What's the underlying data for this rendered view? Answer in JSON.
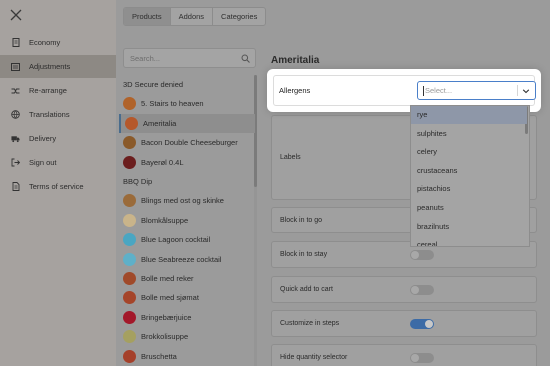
{
  "sidebar": {
    "items": [
      {
        "label": "Economy",
        "icon": "receipt-icon"
      },
      {
        "label": "Adjustments",
        "icon": "sliders-icon"
      },
      {
        "label": "Re-arrange",
        "icon": "shuffle-icon"
      },
      {
        "label": "Translations",
        "icon": "globe-icon"
      },
      {
        "label": "Delivery",
        "icon": "truck-icon"
      },
      {
        "label": "Sign out",
        "icon": "sign-out-icon"
      },
      {
        "label": "Terms of service",
        "icon": "document-icon"
      }
    ]
  },
  "tabs": [
    "Products",
    "Addons",
    "Categories"
  ],
  "search": {
    "placeholder": "Search..."
  },
  "products": [
    {
      "label": "3D Secure denied",
      "type": "group"
    },
    {
      "label": "5. Stairs to heaven",
      "type": "item",
      "color": "#b0632a"
    },
    {
      "label": "Ameritalia",
      "type": "item",
      "color": "#b5582b",
      "selected": true
    },
    {
      "label": "Bacon Double Cheeseburger",
      "type": "item",
      "color": "#8a5a2a"
    },
    {
      "label": "Bayerøl 0.4L",
      "type": "item",
      "color": "#6b1e1e"
    },
    {
      "label": "BBQ Dip",
      "type": "group"
    },
    {
      "label": "Blings med ost og skinke",
      "type": "item",
      "color": "#9a6b3a"
    },
    {
      "label": "Blomkålsuppe",
      "type": "item",
      "color": "#c9b48a"
    },
    {
      "label": "Blue Lagoon cocktail",
      "type": "item",
      "color": "#4aa6c2"
    },
    {
      "label": "Blue Seabreeze cocktail",
      "type": "item",
      "color": "#5fb0c8"
    },
    {
      "label": "Bolle med reker",
      "type": "item",
      "color": "#a04a2a"
    },
    {
      "label": "Bolle med sjømat",
      "type": "item",
      "color": "#a5452a"
    },
    {
      "label": "Bringebærjuice",
      "type": "item",
      "color": "#a3182a"
    },
    {
      "label": "Brokkolisuppe",
      "type": "item",
      "color": "#a5a060"
    },
    {
      "label": "Bruschetta",
      "type": "item",
      "color": "#a5402a"
    }
  ],
  "product_title": "Ameritalia",
  "allergens": {
    "label": "Allergens",
    "placeholder": "Select..."
  },
  "settings": [
    {
      "label": "Labels"
    },
    {
      "label": "Block in to go"
    },
    {
      "label": "Block in to stay",
      "toggle": "off"
    },
    {
      "label": "Quick add to cart",
      "toggle": "off"
    },
    {
      "label": "Customize in steps",
      "toggle": "on"
    },
    {
      "label": "Hide quantity selector",
      "toggle": "off"
    }
  ],
  "dropdown_options": [
    "rye",
    "sulphites",
    "celery",
    "crustaceans",
    "pistachios",
    "peanuts",
    "brazilnuts",
    "cereal"
  ],
  "colors": {
    "accent": "#3c6ba6",
    "select_border": "#4a7fc9"
  }
}
